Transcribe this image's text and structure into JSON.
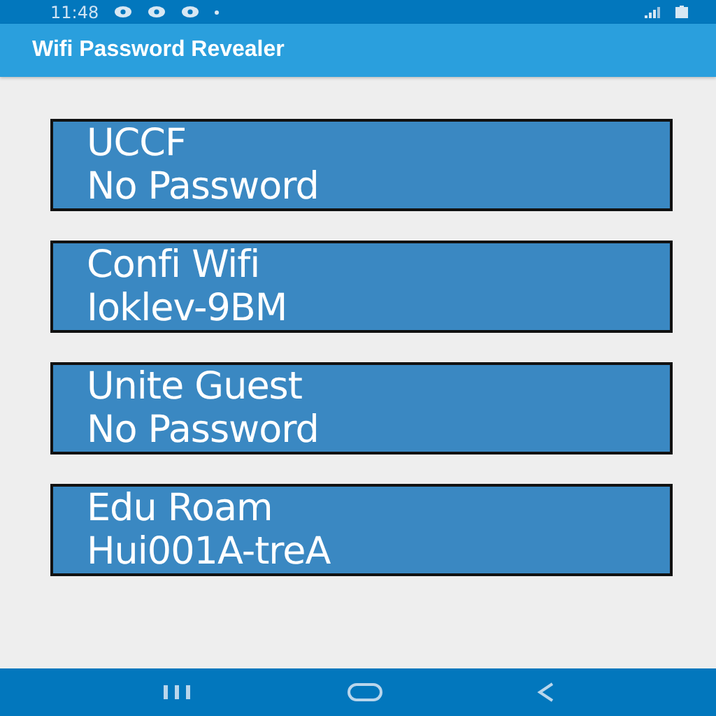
{
  "status_bar": {
    "time": "11:48"
  },
  "app_bar": {
    "title": "Wifi Password Revealer"
  },
  "networks": [
    {
      "name": "UCCF",
      "password": "No Password"
    },
    {
      "name": "Confi Wifi",
      "password": "Ioklev-9BM"
    },
    {
      "name": "Unite Guest",
      "password": "No Password"
    },
    {
      "name": "Edu Roam",
      "password": "Hui001A-treA"
    }
  ]
}
